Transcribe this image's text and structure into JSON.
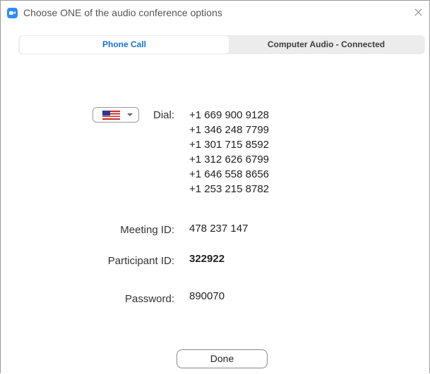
{
  "window": {
    "title": "Choose ONE of the audio conference options",
    "app_icon": "zoom-icon",
    "close_icon": "close-icon"
  },
  "tabs": [
    {
      "label": "Phone Call",
      "selected": true
    },
    {
      "label": "Computer Audio - Connected",
      "selected": false
    }
  ],
  "dial": {
    "country_flag": "us-flag-icon",
    "label": "Dial:",
    "numbers": [
      "+1 669 900 9128",
      "+1 346 248 7799",
      "+1 301 715 8592",
      "+1 312 626 6799",
      "+1 646 558 8656",
      "+1 253 215 8782"
    ]
  },
  "meeting": {
    "meeting_id_label": "Meeting ID:",
    "meeting_id": "478 237 147",
    "participant_id_label": "Participant ID:",
    "participant_id": "322922",
    "password_label": "Password:",
    "password": "890070"
  },
  "actions": {
    "done_label": "Done"
  },
  "colors": {
    "accent": "#1a73d9",
    "tab_bg": "#ececec"
  }
}
